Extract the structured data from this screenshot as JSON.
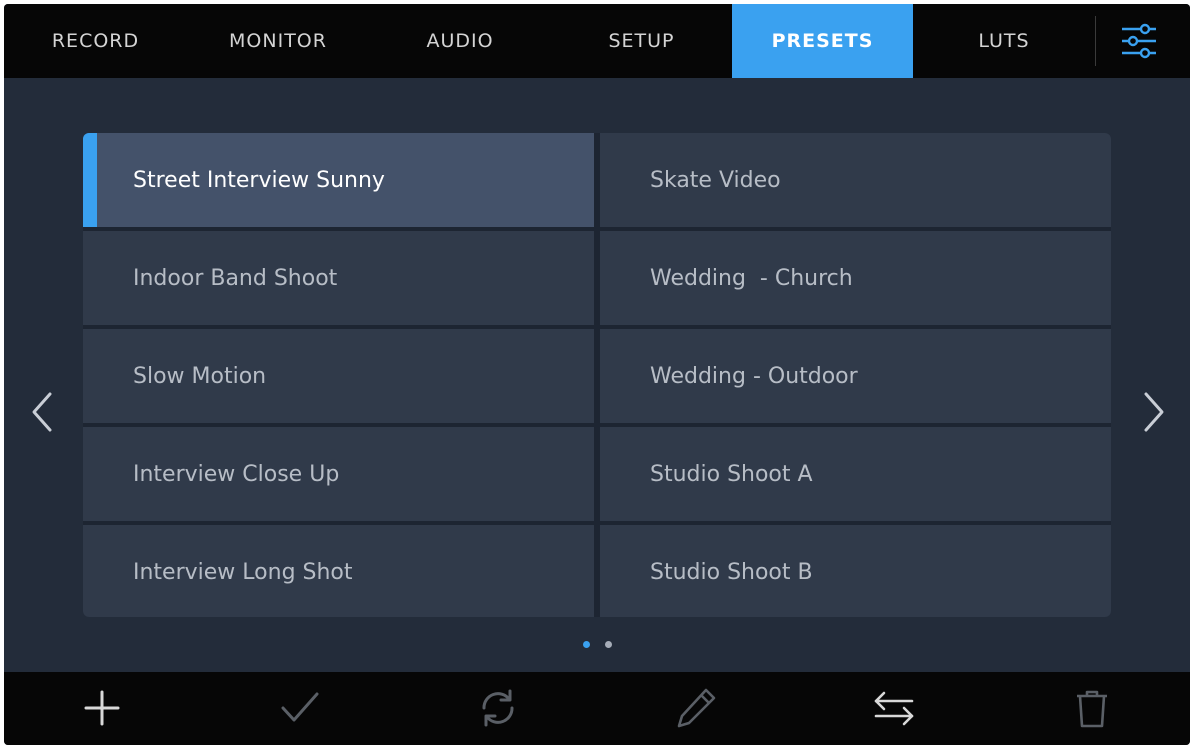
{
  "tabs": [
    {
      "label": "RECORD",
      "active": false
    },
    {
      "label": "MONITOR",
      "active": false
    },
    {
      "label": "AUDIO",
      "active": false
    },
    {
      "label": "SETUP",
      "active": false
    },
    {
      "label": "PRESETS",
      "active": true
    },
    {
      "label": "LUTS",
      "active": false
    }
  ],
  "settings_icon": "sliders-icon",
  "presets": [
    {
      "label": "Street Interview Sunny",
      "selected": true
    },
    {
      "label": "Skate Video",
      "selected": false
    },
    {
      "label": "Indoor Band Shoot",
      "selected": false
    },
    {
      "label": "Wedding  - Church",
      "selected": false
    },
    {
      "label": "Slow Motion",
      "selected": false
    },
    {
      "label": "Wedding - Outdoor",
      "selected": false
    },
    {
      "label": "Interview Close Up",
      "selected": false
    },
    {
      "label": "Studio Shoot A",
      "selected": false
    },
    {
      "label": "Interview Long Shot",
      "selected": false
    },
    {
      "label": "Studio Shoot B",
      "selected": false
    }
  ],
  "pagination": {
    "current_page": 1,
    "total_pages": 2
  },
  "toolbar_icons": [
    "plus-icon",
    "check-icon",
    "refresh-icon",
    "pencil-icon",
    "swap-arrows-icon",
    "trash-icon"
  ],
  "colors": {
    "accent": "#3aa1f0",
    "background": "#232c3a",
    "cell": "#303a4a",
    "cell_selected": "#44526a",
    "bar": "#060606"
  }
}
